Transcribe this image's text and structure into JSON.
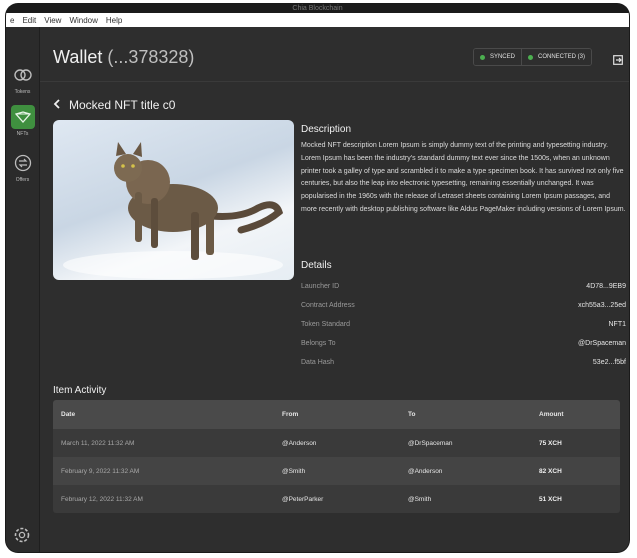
{
  "window": {
    "title": "Chia Blockchain"
  },
  "menu": {
    "items": [
      "e",
      "Edit",
      "View",
      "Window",
      "Help"
    ]
  },
  "sidebar": {
    "items": [
      {
        "label": "Tokens",
        "icon": "tokens-icon"
      },
      {
        "label": "NFTs",
        "icon": "nft-icon",
        "active": true
      },
      {
        "label": "Offers",
        "icon": "offers-icon"
      }
    ],
    "settings_icon": "gear-icon"
  },
  "header": {
    "title": "Wallet",
    "address": "(...378328)",
    "status": [
      {
        "label": "SYNCED",
        "color": "#4caf50"
      },
      {
        "label": "CONNECTED (3)",
        "color": "#4caf50"
      }
    ]
  },
  "nft": {
    "back_icon": "chevron-left-icon",
    "title": "Mocked NFT title c0",
    "description_heading": "Description",
    "description": "Mocked NFT description Lorem Ipsum is simply dummy text of the printing and typesetting industry. Lorem Ipsum has been the industry's standard dummy text ever since the 1500s, when an unknown printer took a galley of type and scrambled it to make a type specimen book. It has survived not only five centuries, but also the leap into electronic typesetting, remaining essentially unchanged. It was popularised in the 1960s with the release of Letraset sheets containing Lorem Ipsum passages, and more recently with desktop publishing software like Aldus PageMaker including versions of Lorem Ipsum.",
    "details_heading": "Details",
    "details": [
      {
        "key": "Launcher ID",
        "value": "4D78...9EB9"
      },
      {
        "key": "Contract Address",
        "value": "xch55a3...25ed"
      },
      {
        "key": "Token Standard",
        "value": "NFT1"
      },
      {
        "key": "Belongs To",
        "value": "@DrSpaceman"
      },
      {
        "key": "Data Hash",
        "value": "53e2...f5bf"
      }
    ]
  },
  "activity": {
    "heading": "Item Activity",
    "columns": [
      "Date",
      "From",
      "To",
      "Amount"
    ],
    "rows": [
      {
        "date": "March 11, 2022 11:32 AM",
        "from": "@Anderson",
        "to": "@DrSpaceman",
        "amount": "75 XCH"
      },
      {
        "date": "February 9, 2022 11:32 AM",
        "from": "@Smith",
        "to": "@Anderson",
        "amount": "82 XCH"
      },
      {
        "date": "February 12, 2022 11:32 AM",
        "from": "@PeterParker",
        "to": "@Smith",
        "amount": "51 XCH"
      }
    ]
  }
}
